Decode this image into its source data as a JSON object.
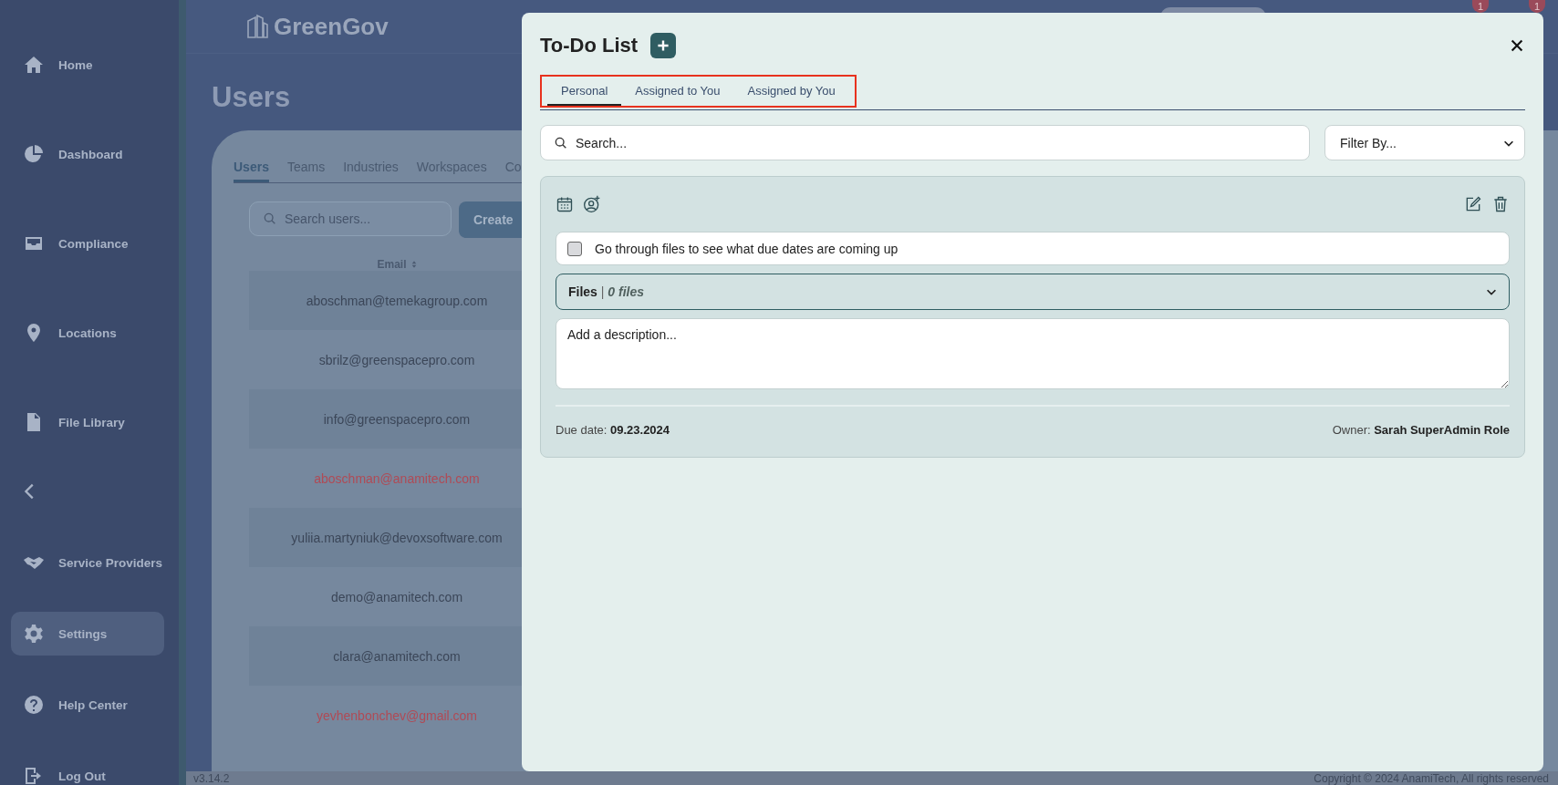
{
  "sidebar": {
    "items": [
      {
        "label": "Home",
        "selected": false
      },
      {
        "label": "Dashboard",
        "selected": false
      },
      {
        "label": "Compliance",
        "selected": false
      },
      {
        "label": "Locations",
        "selected": false
      },
      {
        "label": "File Library",
        "selected": false
      }
    ],
    "bottom_items": [
      {
        "label": "Service Providers",
        "selected": false
      },
      {
        "label": "Settings",
        "selected": true
      },
      {
        "label": "Help Center",
        "selected": false
      },
      {
        "label": "Log Out",
        "selected": false
      }
    ]
  },
  "header": {
    "logo": "GreenGov",
    "badges": [
      "1",
      "1"
    ]
  },
  "page": {
    "title": "Users",
    "tabs": [
      {
        "label": "Users",
        "selected": true
      },
      {
        "label": "Teams",
        "selected": false
      },
      {
        "label": "Industries",
        "selected": false
      },
      {
        "label": "Workspaces",
        "selected": false
      },
      {
        "label": "Co",
        "selected": false
      }
    ],
    "search": {
      "placeholder": "Search users..."
    },
    "create_button": "Create",
    "table": {
      "columns": [
        "Email"
      ],
      "rows": [
        {
          "email": "aboschman@temekagroup.com",
          "color": "#3b4658"
        },
        {
          "email": "sbrilz@greenspacepro.com",
          "color": "#3b4658"
        },
        {
          "email": "info@greenspacepro.com",
          "color": "#3b4658"
        },
        {
          "email": "aboschman@anamitech.com",
          "color": "#b04a55"
        },
        {
          "email": "yuliia.martyniuk@devoxsoftware.com",
          "color": "#3b4658"
        },
        {
          "email": "demo@anamitech.com",
          "color": "#3b4658"
        },
        {
          "email": "clara@anamitech.com",
          "color": "#3b4658"
        },
        {
          "email": "yevhenbonchev@gmail.com",
          "color": "#b04a55"
        }
      ]
    }
  },
  "footer": {
    "version": "v3.14.2",
    "copyright": "Copyright © 2024 AnamiTech, All rights reserved"
  },
  "modal": {
    "title": "To-Do List",
    "tabs_highlighted": true,
    "tabs": [
      {
        "label": "Personal",
        "selected": true
      },
      {
        "label": "Assigned to You",
        "selected": false
      },
      {
        "label": "Assigned by You",
        "selected": false
      }
    ],
    "search": {
      "placeholder": "Search..."
    },
    "filter": {
      "placeholder": "Filter By..."
    },
    "tasks": [
      {
        "checked": false,
        "title": "Go through files to see what due dates are coming up",
        "files_label": "Files",
        "files_separator": "|",
        "files_count": "0 files",
        "description": {
          "placeholder": "Add a description..."
        },
        "due_label": "Due date:",
        "due_date": "09.23.2024",
        "owner_label": "Owner:",
        "owner": "Sarah SuperAdmin Role"
      }
    ]
  }
}
